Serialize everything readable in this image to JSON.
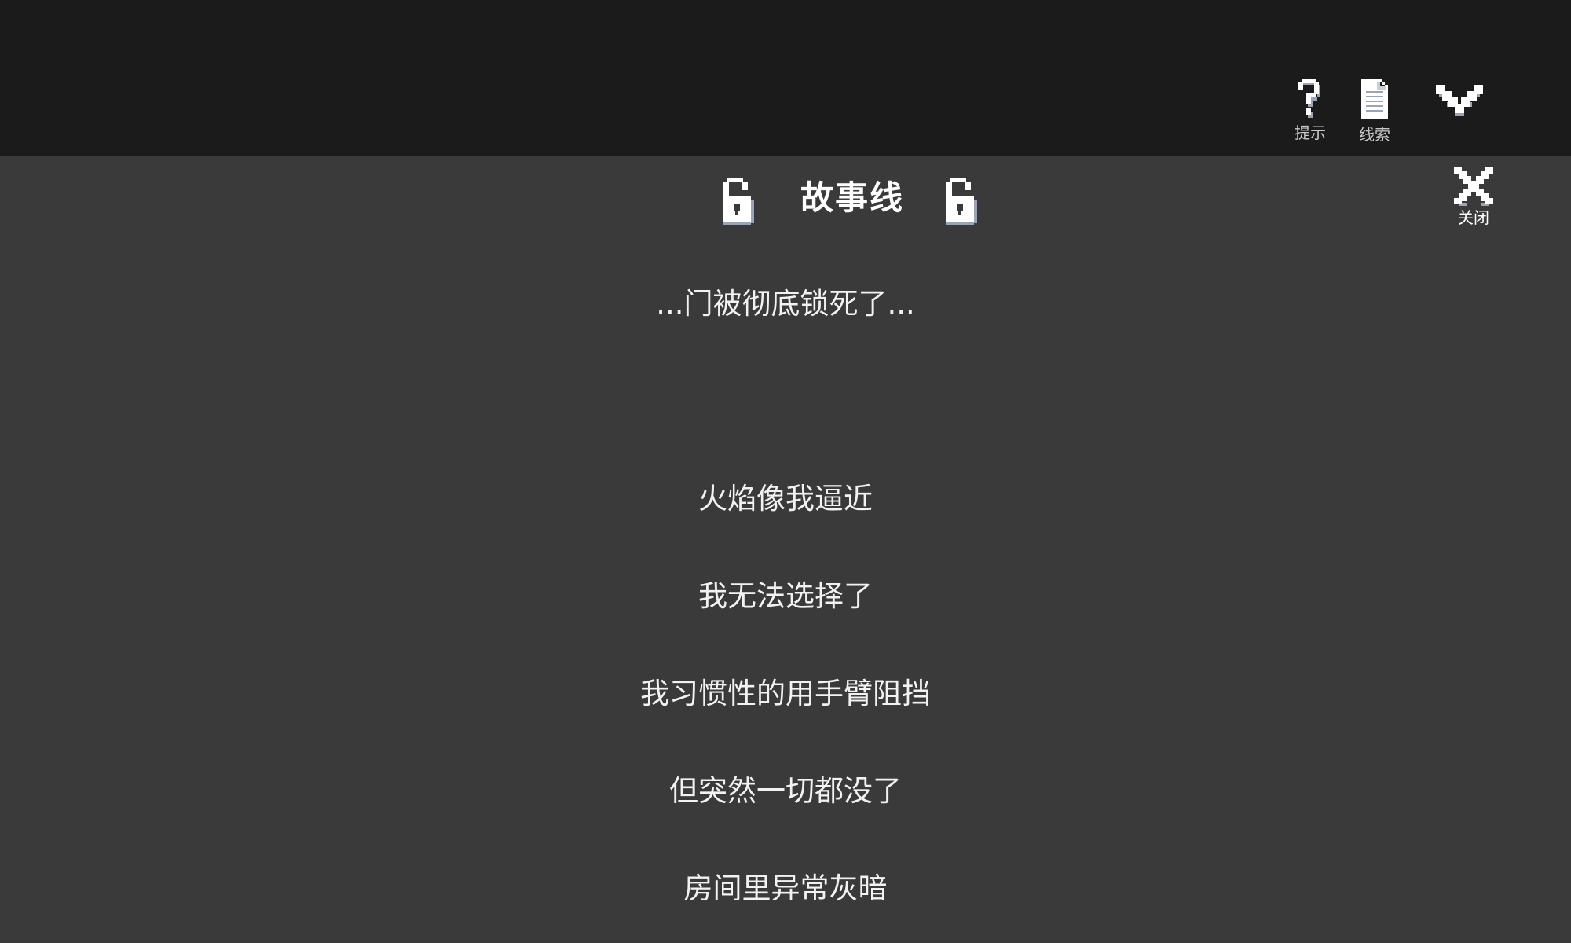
{
  "top_bar": {
    "hint_label": "提示",
    "clues_label": "线索",
    "hint_icon": "question-mark-icon",
    "clues_icon": "document-icon",
    "collapse_icon": "chevron-down-icon"
  },
  "panel": {
    "title": "故事线",
    "title_icon": "unlocked-padlock-icon",
    "close_label": "关闭",
    "close_icon": "close-x-icon"
  },
  "story": {
    "lines": [
      "...门被彻底锁死了...",
      "火焰像我逼近",
      "我无法选择了",
      "我习惯性的用手臂阻挡",
      "但突然一切都没了",
      "房间里异常灰暗"
    ]
  },
  "colors": {
    "top_bar_bg": "#1b1b1b",
    "panel_bg": "#3a3a3a",
    "text": "#ffffff"
  }
}
